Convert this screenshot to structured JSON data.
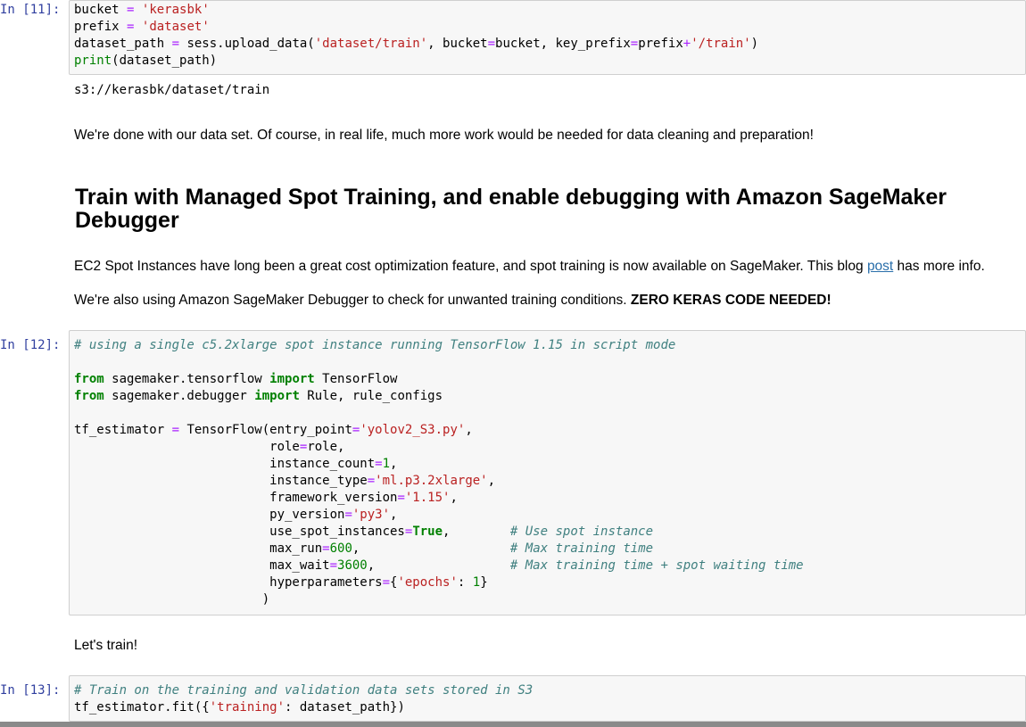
{
  "cells": {
    "c11": {
      "prompt": "In [11]:",
      "lines": [
        "bucket = 'kerasbk'",
        "prefix = 'dataset'",
        "dataset_path = sess.upload_data('dataset/train', bucket=bucket, key_prefix=prefix+'/train')",
        "print(dataset_path)"
      ],
      "output": "s3://kerasbk/dataset/train"
    },
    "md1": "We're done with our data set. Of course, in real life, much more work would be needed for data cleaning and preparation!",
    "heading": "Train with Managed Spot Training, and enable debugging with Amazon SageMaker Debugger",
    "md2": {
      "text_before": "EC2 Spot Instances have long been a great cost optimization feature, and spot training is now available on SageMaker. This blog ",
      "link": "post",
      "text_after": " has more info."
    },
    "md3": {
      "text": "We're also using Amazon SageMaker Debugger to check for unwanted training conditions. ",
      "bold": "ZERO KERAS CODE NEEDED!"
    },
    "c12": {
      "prompt": "In [12]:",
      "lines": [
        "# using a single c5.2xlarge spot instance running TensorFlow 1.15 in script mode",
        "",
        "from sagemaker.tensorflow import TensorFlow",
        "from sagemaker.debugger import Rule, rule_configs",
        "",
        "tf_estimator = TensorFlow(entry_point='yolov2_S3.py',",
        "                          role=role,",
        "                          instance_count=1,",
        "                          instance_type='ml.p3.2xlarge',",
        "                          framework_version='1.15',",
        "                          py_version='py3',",
        "                          use_spot_instances=True,        # Use spot instance",
        "                          max_run=600,                    # Max training time",
        "                          max_wait=3600,                  # Max training time + spot waiting time",
        "                          hyperparameters={'epochs': 1}",
        "                         )"
      ]
    },
    "md4": "Let's train!",
    "c13": {
      "prompt": "In [13]:",
      "lines": [
        "# Train on the training and validation data sets stored in S3",
        "tf_estimator.fit({'training': dataset_path})"
      ]
    }
  },
  "colors": {
    "prompt": "#303f9f",
    "keyword": "#008000",
    "string": "#ba2121",
    "operator": "#aa22ff",
    "comment": "#408080",
    "link": "#296eaa"
  }
}
